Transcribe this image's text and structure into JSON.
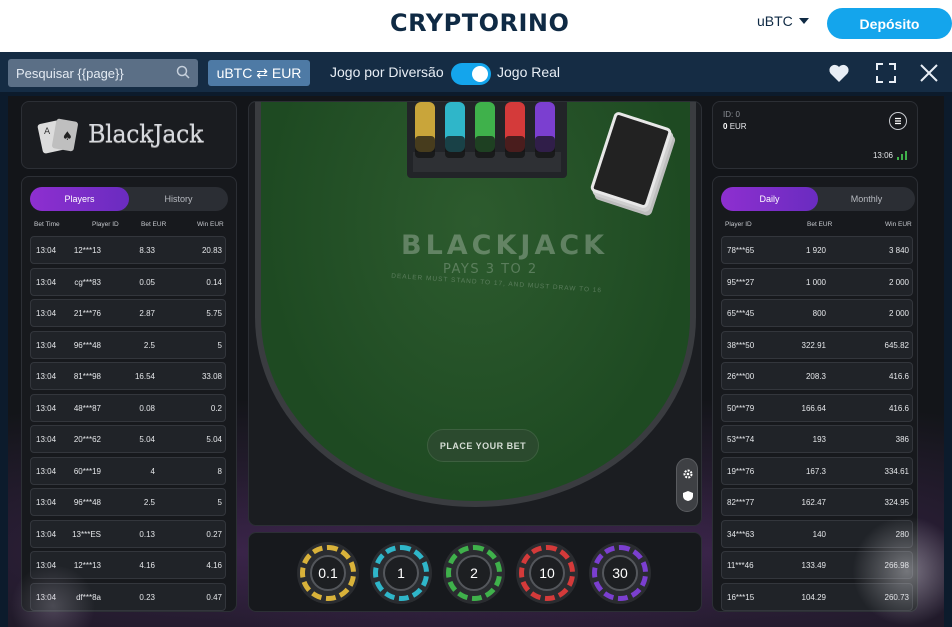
{
  "site": {
    "logo": "CRYPTORINO",
    "currency": "uBTC",
    "deposit_label": "Depósito"
  },
  "toolbar": {
    "search_placeholder": "Pesquisar {{page}}",
    "convert_label": "uBTC ⇄ EUR",
    "mode_fun": "Jogo por Diversão",
    "mode_real": "Jogo Real",
    "toggle_on": true
  },
  "game": {
    "logo_text": "BlackJack",
    "table_title": "BLACKJACK",
    "table_subtitle": "PAYS 3 TO 2",
    "table_rule": "DEALER MUST STAND TO 17, AND MUST DRAW TO 16",
    "place_bet": "PLACE YOUR BET",
    "chips": [
      {
        "value": "0.1",
        "color": "#d9b23a"
      },
      {
        "value": "1",
        "color": "#2fb6c9"
      },
      {
        "value": "2",
        "color": "#3fb14b"
      },
      {
        "value": "10",
        "color": "#d43a3a"
      },
      {
        "value": "30",
        "color": "#7b3fd0"
      }
    ]
  },
  "info": {
    "id_label": "ID: 0",
    "balance": "0",
    "balance_currency": "EUR",
    "time": "13:06"
  },
  "left_table": {
    "tabs": [
      "Players",
      "History"
    ],
    "active_tab": "Players",
    "headers": [
      "Bet Time",
      "Player ID",
      "Bet  EUR",
      "Win  EUR"
    ],
    "rows": [
      [
        "13:04",
        "12***13",
        "8.33",
        "20.83"
      ],
      [
        "13:04",
        "cg***83",
        "0.05",
        "0.14"
      ],
      [
        "13:04",
        "21***76",
        "2.87",
        "5.75"
      ],
      [
        "13:04",
        "96***48",
        "2.5",
        "5"
      ],
      [
        "13:04",
        "81***98",
        "16.54",
        "33.08"
      ],
      [
        "13:04",
        "48***87",
        "0.08",
        "0.2"
      ],
      [
        "13:04",
        "20***62",
        "5.04",
        "5.04"
      ],
      [
        "13:04",
        "60***19",
        "4",
        "8"
      ],
      [
        "13:04",
        "96***48",
        "2.5",
        "5"
      ],
      [
        "13:04",
        "13***ES",
        "0.13",
        "0.27"
      ],
      [
        "13:04",
        "12***13",
        "4.16",
        "4.16"
      ],
      [
        "13:04",
        "df***8a",
        "0.23",
        "0.47"
      ]
    ]
  },
  "right_table": {
    "tabs": [
      "Daily",
      "Monthly"
    ],
    "active_tab": "Daily",
    "headers": [
      "Player ID",
      "Bet  EUR",
      "Win  EUR"
    ],
    "rows": [
      [
        "78***65",
        "1 920",
        "3 840"
      ],
      [
        "95***27",
        "1 000",
        "2 000"
      ],
      [
        "65***45",
        "800",
        "2 000"
      ],
      [
        "38***50",
        "322.91",
        "645.82"
      ],
      [
        "26***00",
        "208.3",
        "416.6"
      ],
      [
        "50***79",
        "166.64",
        "416.6"
      ],
      [
        "53***74",
        "193",
        "386"
      ],
      [
        "19***76",
        "167.3",
        "334.61"
      ],
      [
        "82***77",
        "162.47",
        "324.95"
      ],
      [
        "34***63",
        "140",
        "280"
      ],
      [
        "11***46",
        "133.49",
        "266.98"
      ],
      [
        "16***15",
        "104.29",
        "260.73"
      ]
    ]
  }
}
